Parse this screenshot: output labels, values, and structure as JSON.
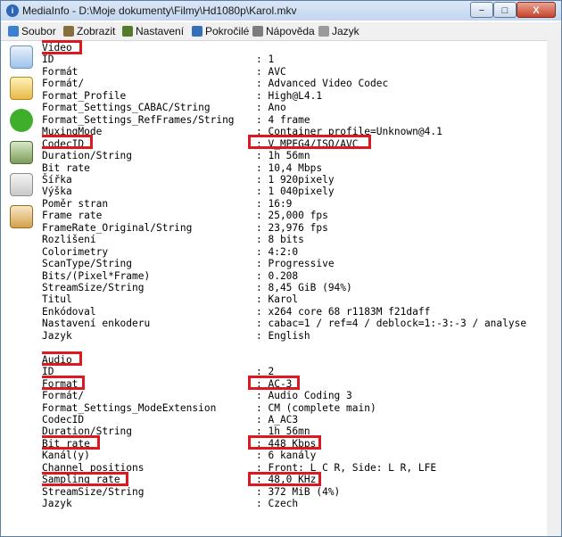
{
  "window": {
    "title": "MediaInfo - D:\\Moje dokumenty\\Filmy\\Hd1080p\\Karol.mkv",
    "minimize_label": "−",
    "maximize_label": "□",
    "close_label": "X"
  },
  "menu": [
    {
      "label": "Soubor",
      "icon": "folder-icon",
      "color": "#3d7fd0"
    },
    {
      "label": "Zobrazit",
      "icon": "view-icon",
      "color": "#8a6e3a"
    },
    {
      "label": "Nastavení",
      "icon": "settings-icon",
      "color": "#557a2a"
    },
    {
      "label": "Pokročilé",
      "icon": "advanced-icon",
      "color": "#3470b8"
    },
    {
      "label": "Nápověda",
      "icon": "help-icon",
      "color": "#7d7d7d"
    },
    {
      "label": "Jazyk",
      "icon": "language-icon",
      "color": "#9a9a9a"
    }
  ],
  "sidebar_icons": [
    "open-file-icon",
    "open-folder-icon",
    "forward-arrow-icon",
    "export-icon",
    "email-icon",
    "donate-icon"
  ],
  "highlight_color": "#dd1820",
  "video_section": {
    "header": "Video",
    "rows": [
      {
        "key": "ID",
        "value": ": 1"
      },
      {
        "key": "Formát",
        "value": ": AVC"
      },
      {
        "key": "Formát/",
        "value": ": Advanced Video Codec"
      },
      {
        "key": "Format_Profile",
        "value": ": High@L4.1"
      },
      {
        "key": "Format_Settings_CABAC/String",
        "value": ": Ano"
      },
      {
        "key": "Format_Settings_RefFrames/String",
        "value": ": 4 frame"
      },
      {
        "key": "MuxingMode",
        "value": ": Container profile=Unknown@4.1"
      },
      {
        "key": "CodecID",
        "value": ": V_MPEG4/ISO/AVC"
      },
      {
        "key": "Duration/String",
        "value": ": 1h 56mn"
      },
      {
        "key": "Bit rate",
        "value": ": 10,4 Mbps"
      },
      {
        "key": "Šířka",
        "value": ": 1 920pixely"
      },
      {
        "key": "Výška",
        "value": ": 1 040pixely"
      },
      {
        "key": "Poměr stran",
        "value": ": 16:9"
      },
      {
        "key": "Frame rate",
        "value": ": 25,000 fps"
      },
      {
        "key": "FrameRate_Original/String",
        "value": ": 23,976 fps"
      },
      {
        "key": "Rozlišení",
        "value": ": 8 bits"
      },
      {
        "key": "Colorimetry",
        "value": ": 4:2:0"
      },
      {
        "key": "ScanType/String",
        "value": ": Progressive"
      },
      {
        "key": "Bits/(Pixel*Frame)",
        "value": ": 0.208"
      },
      {
        "key": "StreamSize/String",
        "value": ": 8,45 GiB (94%)"
      },
      {
        "key": "Titul",
        "value": ": Karol"
      },
      {
        "key": "Enkódoval",
        "value": ": x264 core 68 r1183M f21daff"
      },
      {
        "key": "Nastavení enkoderu",
        "value": ": cabac=1 / ref=4 / deblock=1:-3:-3 / analyse"
      },
      {
        "key": "Jazyk",
        "value": ": English"
      }
    ]
  },
  "audio_section": {
    "header": "Audio",
    "rows": [
      {
        "key": "ID",
        "value": ": 2"
      },
      {
        "key": "Format",
        "value": ": AC-3"
      },
      {
        "key": "Formát/",
        "value": ": Audio Coding 3"
      },
      {
        "key": "Format_Settings_ModeExtension",
        "value": ": CM (complete main)"
      },
      {
        "key": "CodecID",
        "value": ": A_AC3"
      },
      {
        "key": "Duration/String",
        "value": ": 1h 56mn"
      },
      {
        "key": "Bit rate",
        "value": ": 448 Kbps"
      },
      {
        "key": "Kanál(y)",
        "value": ": 6 kanály"
      },
      {
        "key": "Channel positions",
        "value": ": Front: L C R, Side: L R, LFE"
      },
      {
        "key": "Sampling rate",
        "value": ": 48,0 KHz"
      },
      {
        "key": "StreamSize/String",
        "value": ": 372 MiB (4%)"
      },
      {
        "key": "Jazyk",
        "value": ": Czech"
      }
    ]
  }
}
